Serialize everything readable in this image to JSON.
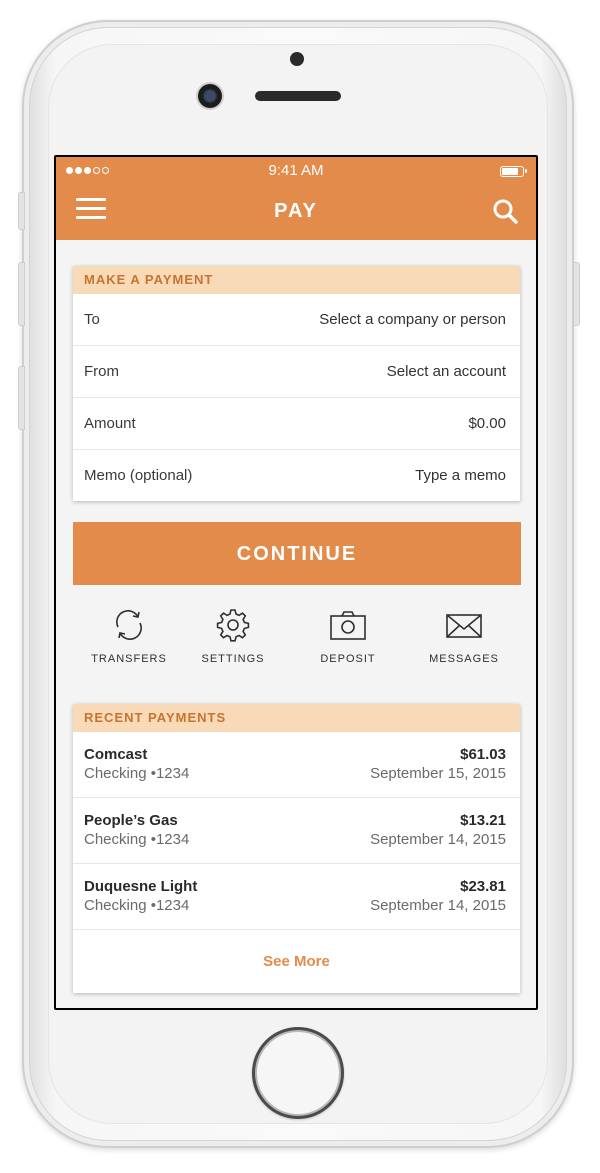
{
  "colors": {
    "accent": "#e38b4a",
    "section_header_bg": "#f8d9b8",
    "section_header_text": "#c8742f"
  },
  "status_bar": {
    "time": "9:41 AM",
    "signal_icon": "signal-dots-icon",
    "battery_icon": "battery-icon",
    "battery_level": 0.9
  },
  "header": {
    "title": "PAY",
    "menu_icon": "hamburger-menu-icon",
    "search_icon": "search-icon"
  },
  "payment_form": {
    "title": "MAKE A PAYMENT",
    "rows": [
      {
        "label": "To",
        "value": "Select a company or person"
      },
      {
        "label": "From",
        "value": "Select an account"
      },
      {
        "label": "Amount",
        "value": "$0.00"
      },
      {
        "label": "Memo (optional)",
        "value": "Type a memo"
      }
    ],
    "continue_label": "CONTINUE"
  },
  "actions": [
    {
      "label": "TRANSFERS",
      "icon": "refresh-arrows-icon"
    },
    {
      "label": "SETTINGS",
      "icon": "gear-icon"
    },
    {
      "label": "DEPOSIT",
      "icon": "camera-icon"
    },
    {
      "label": "MESSAGES",
      "icon": "envelope-icon"
    }
  ],
  "recent_payments": {
    "title": "RECENT PAYMENTS",
    "items": [
      {
        "payee": "Comcast",
        "account": "Checking •1234",
        "amount": "$61.03",
        "date": "September 15, 2015"
      },
      {
        "payee": "People’s Gas",
        "account": "Checking •1234",
        "amount": "$13.21",
        "date": "September 14, 2015"
      },
      {
        "payee": "Duquesne Light",
        "account": "Checking •1234",
        "amount": "$23.81",
        "date": "September 14, 2015"
      }
    ],
    "see_more_label": "See More"
  }
}
